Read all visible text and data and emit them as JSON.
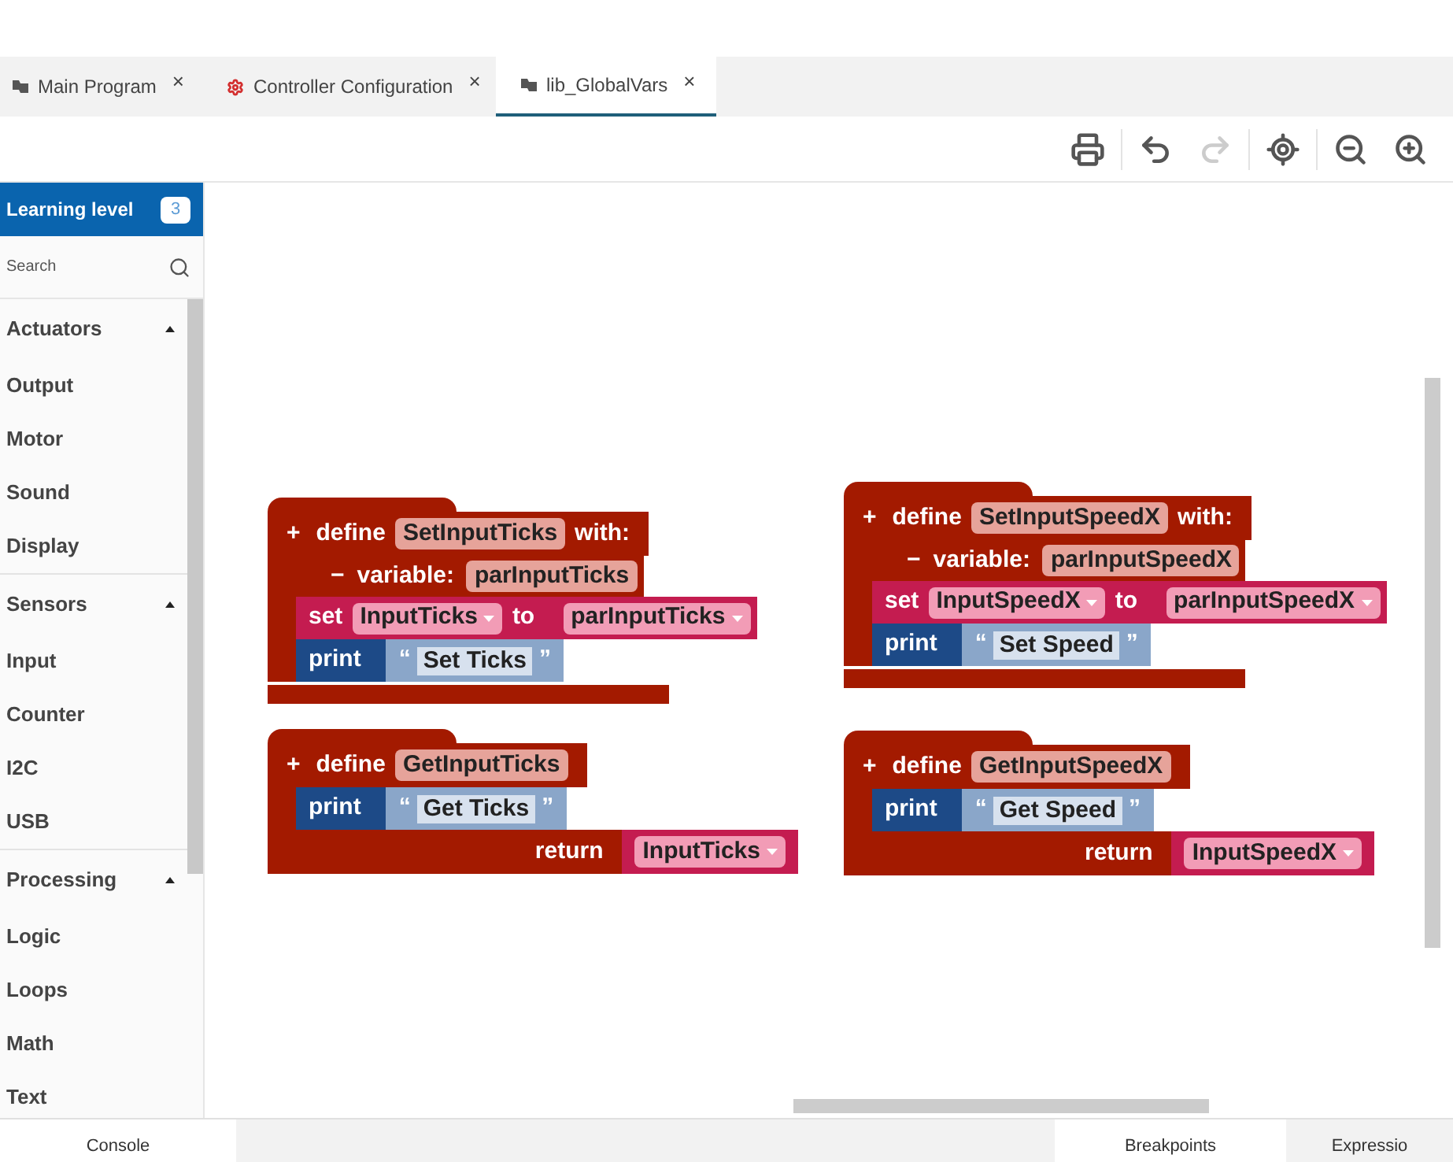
{
  "tabs": [
    {
      "label": "Main Program",
      "kind": "program",
      "selected": false,
      "close": "×"
    },
    {
      "label": "Controller Configuration",
      "kind": "config",
      "selected": false,
      "close": "×"
    },
    {
      "label": "lib_GlobalVars",
      "kind": "program",
      "selected": true,
      "close": "×"
    }
  ],
  "toolbar": [
    {
      "kind": "print",
      "disabled": false
    },
    {
      "kind": "undo",
      "disabled": false
    },
    {
      "kind": "redo",
      "disabled": true
    },
    {
      "kind": "center",
      "disabled": false
    },
    {
      "kind": "zoom_out",
      "disabled": false
    },
    {
      "kind": "zoom_in",
      "disabled": false
    }
  ],
  "sidebar": {
    "learning_level": {
      "label": "Learning level",
      "value": "3"
    },
    "search": {
      "placeholder": "Search"
    },
    "categories": [
      {
        "label": "Actuators",
        "expanded": true,
        "children": [
          {
            "label": "Output"
          },
          {
            "label": "Motor"
          },
          {
            "label": "Sound"
          },
          {
            "label": "Display"
          }
        ]
      },
      {
        "label": "Sensors",
        "expanded": true,
        "children": [
          {
            "label": "Input"
          },
          {
            "label": "Counter"
          },
          {
            "label": "I2C"
          },
          {
            "label": "USB"
          }
        ]
      },
      {
        "label": "Processing",
        "expanded": true,
        "children": [
          {
            "label": "Logic"
          },
          {
            "label": "Loops"
          },
          {
            "label": "Math"
          },
          {
            "label": "Text"
          }
        ]
      }
    ]
  },
  "canvas": {
    "blocks": [
      {
        "kind": "define",
        "plus": "+",
        "keyword": "define",
        "name": "SetInputTicks",
        "with": "with:",
        "params": [
          {
            "minus": "−",
            "label": "variable:",
            "name": "parInputTicks"
          }
        ],
        "body": [
          {
            "kind": "set",
            "keyword": "set",
            "variable": "InputTicks",
            "to": "to",
            "value": "parInputTicks"
          },
          {
            "kind": "print",
            "keyword": "print",
            "open_quote": "“",
            "text": "Set Ticks",
            "close_quote": "”"
          }
        ]
      },
      {
        "kind": "define",
        "plus": "+",
        "keyword": "define",
        "name": "SetInputSpeedX",
        "with": "with:",
        "params": [
          {
            "minus": "−",
            "label": "variable:",
            "name": "parInputSpeedX"
          }
        ],
        "body": [
          {
            "kind": "set",
            "keyword": "set",
            "variable": "InputSpeedX",
            "to": "to",
            "value": "parInputSpeedX"
          },
          {
            "kind": "print",
            "keyword": "print",
            "open_quote": "“",
            "text": "Set Speed",
            "close_quote": "”"
          }
        ]
      },
      {
        "kind": "define_return",
        "plus": "+",
        "keyword": "define",
        "name": "GetInputTicks",
        "body": [
          {
            "kind": "print",
            "keyword": "print",
            "open_quote": "“",
            "text": "Get Ticks",
            "close_quote": "”"
          }
        ],
        "return": {
          "keyword": "return",
          "variable": "InputTicks"
        }
      },
      {
        "kind": "define_return",
        "plus": "+",
        "keyword": "define",
        "name": "GetInputSpeedX",
        "body": [
          {
            "kind": "print",
            "keyword": "print",
            "open_quote": "“",
            "text": "Get Speed",
            "close_quote": "”"
          }
        ],
        "return": {
          "keyword": "return",
          "variable": "InputSpeedX"
        }
      }
    ]
  },
  "bottom_tabs": [
    {
      "label": "Console",
      "selected": true
    },
    {
      "label": "Breakpoints",
      "selected": true
    },
    {
      "label": "Expressio",
      "selected": false
    }
  ]
}
